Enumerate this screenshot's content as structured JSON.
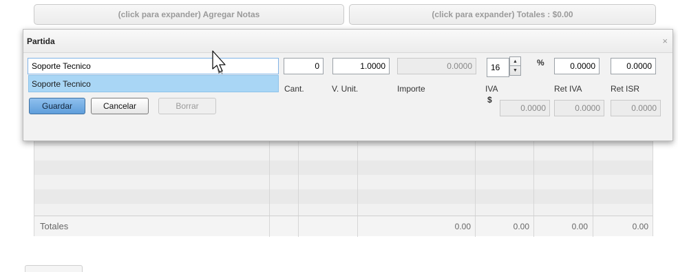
{
  "expanders": {
    "notas": "(click para expander) Agregar Notas",
    "totales": "(click para expander) Totales : $0.00"
  },
  "grid": {
    "totals_label": "Totales",
    "totals_values": [
      "0.00",
      "0.00",
      "0.00",
      "0.00"
    ]
  },
  "modal": {
    "title": "Partida",
    "close": "×",
    "description_value": "Soporte Tecnico",
    "autocomplete": [
      "Soporte Tecnico"
    ],
    "cant_value": "0",
    "vunit_value": "1.0000",
    "importe_value": "0.0000",
    "iva_rate_value": "16",
    "percent_symbol": "%",
    "ret_iva_value": "0.0000",
    "ret_isr_value": "0.0000",
    "labels": {
      "cant": "Cant.",
      "vunit": "V. Unit.",
      "importe": "Importe",
      "iva": "IVA",
      "ret_iva": "Ret IVA",
      "ret_isr": "Ret ISR",
      "dollar": "$"
    },
    "iva_amount": "0.0000",
    "ret_iva_amount": "0.0000",
    "ret_isr_amount": "0.0000",
    "buttons": {
      "guardar": "Guardar",
      "cancelar": "Cancelar",
      "borrar": "Borrar"
    }
  }
}
